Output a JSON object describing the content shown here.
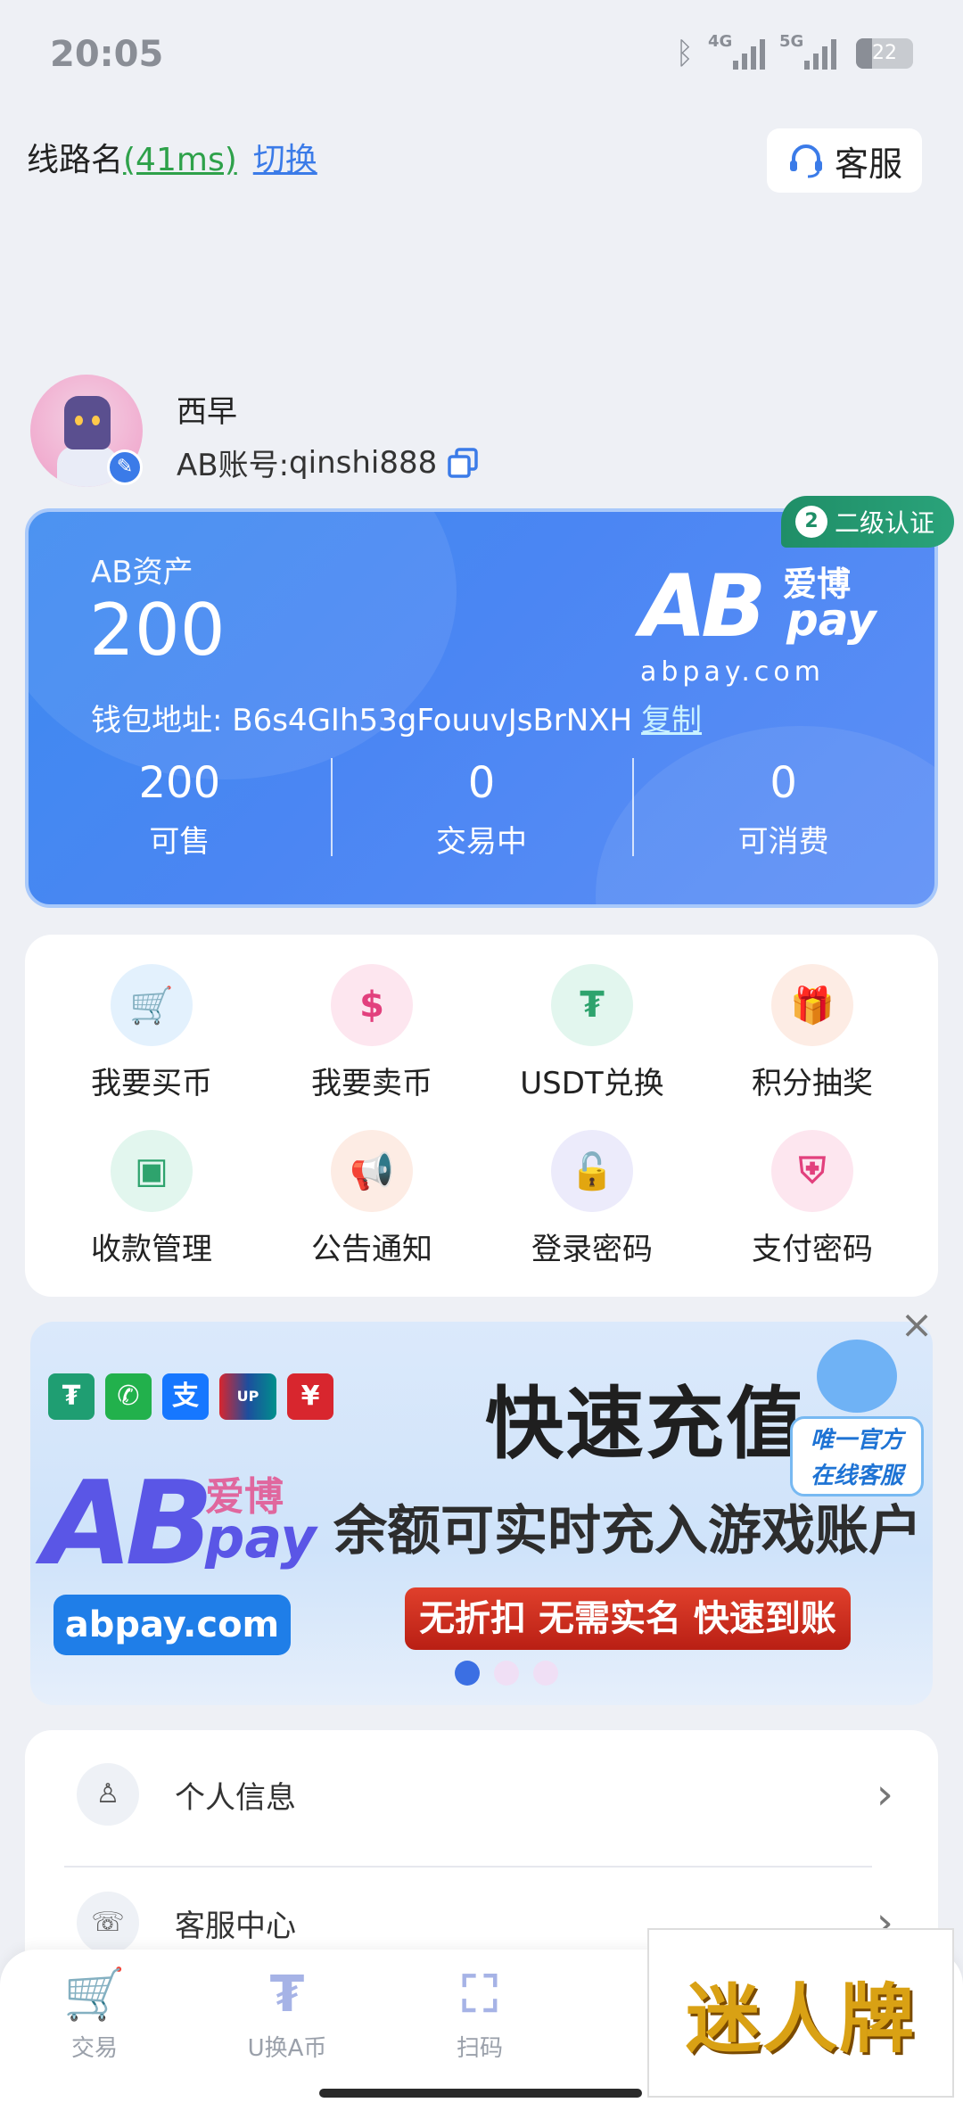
{
  "status": {
    "time": "20:05",
    "net1": "4G",
    "net2": "5G",
    "battery": "22"
  },
  "header": {
    "line_name": "线路名",
    "ping": "(41ms)",
    "switch_label": "切换",
    "cs_label": "客服"
  },
  "profile": {
    "nickname": "西早",
    "account_prefix": "AB账号: ",
    "account": "qinshi888"
  },
  "asset": {
    "label": "AB资产",
    "value": "200",
    "wallet_prefix": "钱包地址: ",
    "wallet_address": "B6s4GIh53gFouuvJsBrNXH",
    "copy_label": "复制",
    "brand_ab": "AB",
    "brand_cn": "爱博",
    "brand_pay": "pay",
    "brand_domain": "abpay.com",
    "cert_label": "二级认证",
    "cert_level": "2",
    "stats": [
      {
        "num": "200",
        "label": "可售"
      },
      {
        "num": "0",
        "label": "交易中"
      },
      {
        "num": "0",
        "label": "可消费"
      }
    ]
  },
  "grid": [
    {
      "label": "我要买币",
      "icon": "cart-icon",
      "glyph": "🛒",
      "bg": "#e3f1fd",
      "fg": "#3b8be6"
    },
    {
      "label": "我要卖币",
      "icon": "sell-coin-icon",
      "glyph": "$",
      "bg": "#fde6ef",
      "fg": "#e2407d"
    },
    {
      "label": "USDT兑换",
      "icon": "usdt-exchange-icon",
      "glyph": "₮",
      "bg": "#e2f6ee",
      "fg": "#2ea36d"
    },
    {
      "label": "积分抽奖",
      "icon": "gift-icon",
      "glyph": "🎁",
      "bg": "#fdece4",
      "fg": "#f07a3a"
    },
    {
      "label": "收款管理",
      "icon": "wallet-icon",
      "glyph": "▣",
      "bg": "#e2f6ee",
      "fg": "#2ea36d"
    },
    {
      "label": "公告通知",
      "icon": "megaphone-icon",
      "glyph": "📢",
      "bg": "#fdece4",
      "fg": "#f07a3a"
    },
    {
      "label": "登录密码",
      "icon": "lock-icon",
      "glyph": "🔓",
      "bg": "#ecebfb",
      "fg": "#6d68e0"
    },
    {
      "label": "支付密码",
      "icon": "shield-icon",
      "glyph": "⛨",
      "bg": "#fde6ef",
      "fg": "#e2407d"
    }
  ],
  "banner": {
    "title": "快速充值",
    "subtitle": "余额可实时充入游戏账户",
    "ribbon": "无折扣 无需实名 快速到账",
    "domain": "abpay.com",
    "brand_ab": "AB",
    "brand_cn": "爱博",
    "brand_pay": "pay",
    "agent_tag_line1": "唯一官方",
    "agent_tag_line2": "在线客服",
    "active_dot": 0
  },
  "menu": [
    {
      "label": "个人信息",
      "icon": "user-info-icon"
    },
    {
      "label": "客服中心",
      "icon": "headset-24h-icon"
    }
  ],
  "tabbar": [
    {
      "label": "交易",
      "icon": "trade-cart-icon"
    },
    {
      "label": "U换A币",
      "icon": "usdt-icon"
    },
    {
      "label": "扫码",
      "icon": "scan-icon"
    }
  ],
  "promo": {
    "text": "迷人牌"
  }
}
